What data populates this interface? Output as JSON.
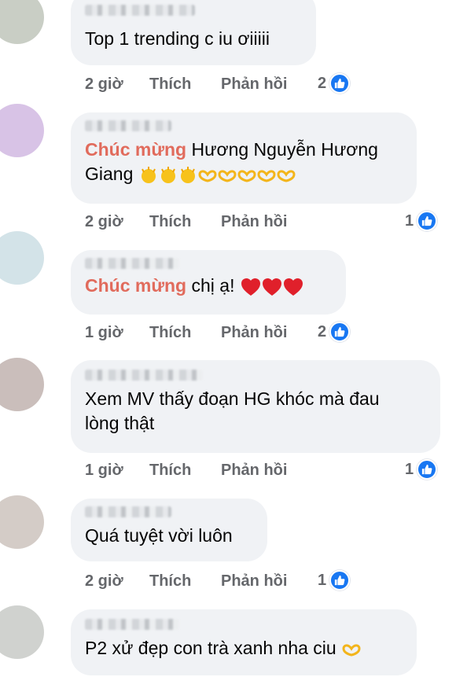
{
  "actions": {
    "like": "Thích",
    "reply": "Phản hồi"
  },
  "colors": {
    "mention": "#e16b5c",
    "bubble": "#f0f2f5",
    "like_blue": "#1877f2"
  },
  "comments": [
    {
      "text": "Top 1 trending c iu ơiiiii",
      "time": "2 giờ",
      "reactions": "2"
    },
    {
      "mention": "Chúc mừng",
      "text_line1": " Hương Nguyễn Hương",
      "text_line2": "Giang",
      "emojis": [
        "clapping-hands",
        "clapping-hands",
        "clapping-hands",
        "heart-hands",
        "heart-hands",
        "heart-hands",
        "heart-hands",
        "heart-hands"
      ],
      "time": "2 giờ",
      "reactions": "1"
    },
    {
      "mention": "Chúc mừng",
      "text": " chị ạ! ",
      "emojis": [
        "red-heart",
        "red-heart",
        "red-heart"
      ],
      "time": "1 giờ",
      "reactions": "2"
    },
    {
      "text_line1": "Xem MV thấy đoạn HG khóc mà đau",
      "text_line2": "lòng thật",
      "time": "1 giờ",
      "reactions": "1"
    },
    {
      "text": "Quá tuyệt vời luôn",
      "time": "2 giờ",
      "reactions": "1"
    },
    {
      "text": "P2 xử đẹp con trà xanh nha ciu ",
      "emojis": [
        "heart-hands"
      ]
    }
  ]
}
